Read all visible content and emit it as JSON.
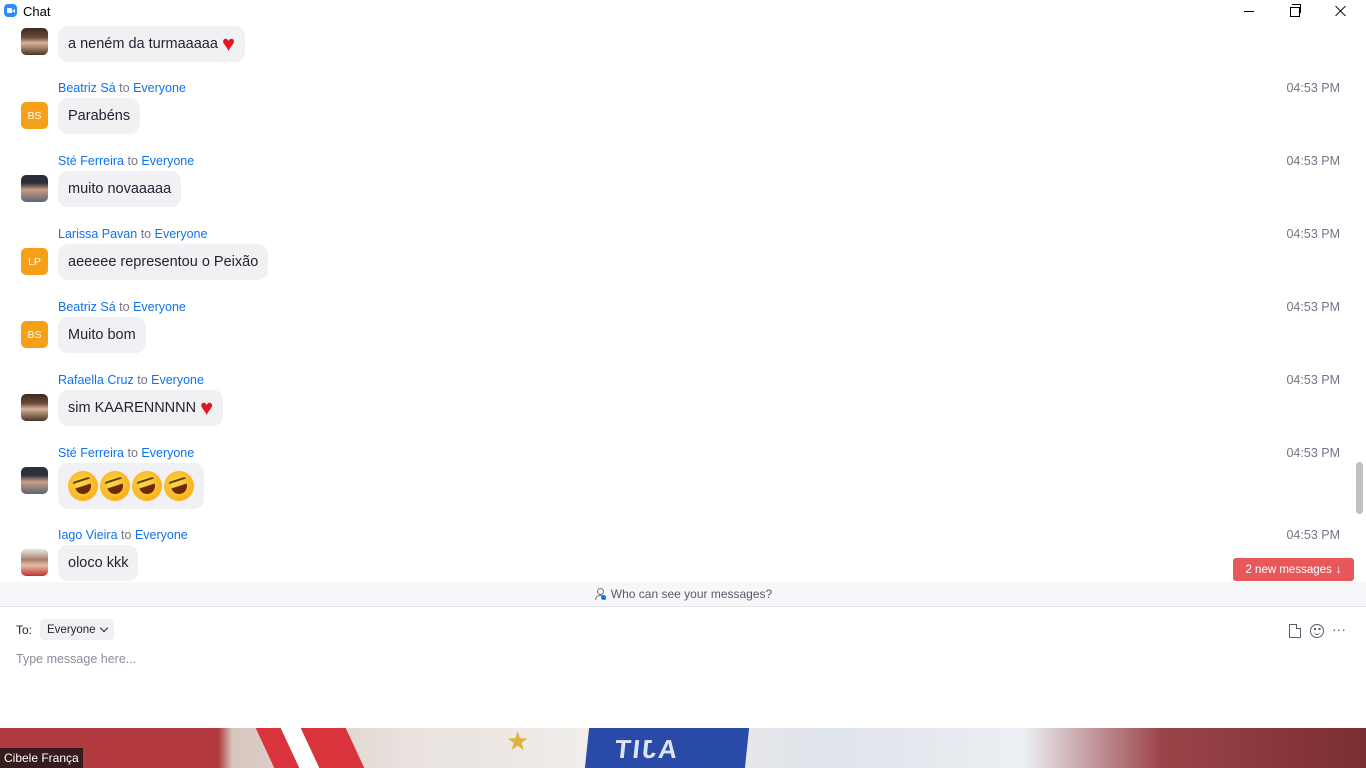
{
  "window": {
    "title": "Chat"
  },
  "messages": [
    {
      "sender": "",
      "to": "",
      "target": "",
      "time": "",
      "text": "a neném da turmaaaaa",
      "heart": true,
      "avatar": "photo"
    },
    {
      "sender": "Beatriz Sá",
      "to": "to",
      "target": "Everyone",
      "time": "04:53 PM",
      "text": "Parabéns",
      "avatar_initials": "BS"
    },
    {
      "sender": "Sté Ferreira",
      "to": "to",
      "target": "Everyone",
      "time": "04:53 PM",
      "text": "muito novaaaaa",
      "avatar": "photo"
    },
    {
      "sender": "Larissa Pavan",
      "to": "to",
      "target": "Everyone",
      "time": "04:53 PM",
      "text": "aeeeee representou o Peixão",
      "avatar_initials": "LP"
    },
    {
      "sender": "Beatriz Sá",
      "to": "to",
      "target": "Everyone",
      "time": "04:53 PM",
      "text": "Muito bom",
      "avatar_initials": "BS"
    },
    {
      "sender": "Rafaella Cruz",
      "to": "to",
      "target": "Everyone",
      "time": "04:53 PM",
      "text": "sim KAARENNNNN",
      "heart": true,
      "avatar": "photo"
    },
    {
      "sender": "Sté Ferreira",
      "to": "to",
      "target": "Everyone",
      "time": "04:53 PM",
      "emoji": "rolling-on-floor-laughing",
      "emoji_count": 4,
      "avatar": "photo"
    },
    {
      "sender": "Iago Vieira",
      "to": "to",
      "target": "Everyone",
      "time": "04:53 PM",
      "text": "oloco kkk",
      "avatar": "photo"
    }
  ],
  "heart_glyph": "♥",
  "new_messages": {
    "label": "2 new messages",
    "arrow": "↓"
  },
  "privacy": {
    "label": "Who can see your messages?"
  },
  "composer": {
    "to_label": "To:",
    "recipient": "Everyone",
    "placeholder": "Type message here...",
    "more_glyph": "···"
  },
  "video": {
    "participant_name": "Cibele França"
  },
  "colors": {
    "accent": "#0e72ed",
    "avatar_initials_bg": "#f6a01a",
    "new_messages_bg": "#e8585b",
    "heart": "#e81224"
  }
}
